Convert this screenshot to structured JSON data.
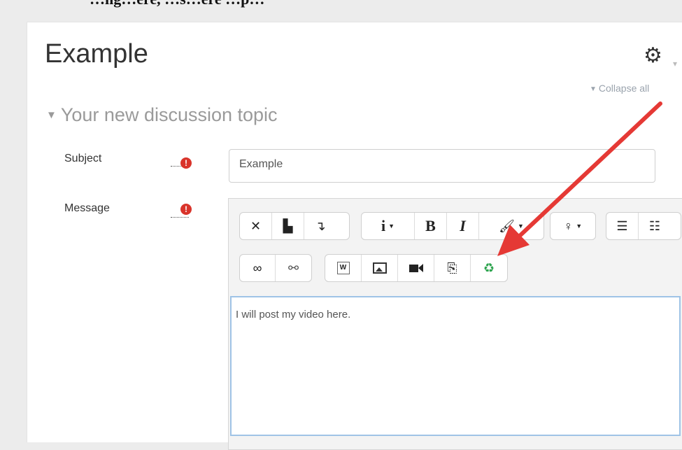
{
  "caption": "…ng…ere, …s…ere …p…",
  "page": {
    "title": "Example"
  },
  "header": {
    "gear_icon": "gear-icon",
    "collapse_all": "Collapse all"
  },
  "section": {
    "title": "Your new discussion topic"
  },
  "form": {
    "subject_label": "Subject",
    "subject_value": "Example",
    "message_label": "Message",
    "required_symbol": "!",
    "message_text": "I will post my video here."
  },
  "toolbar": {
    "row1_group1": [
      "fullscreen-icon",
      "paste-icon",
      "indent-icon"
    ],
    "row1_group2": [
      "info-icon",
      "bold-icon",
      "italic-icon",
      "brush-icon"
    ],
    "row1_group3": [
      "bulb-icon"
    ],
    "row1_group4": [
      "bullet-list-icon",
      "numbered-list-icon"
    ],
    "row2_group1": [
      "link-icon",
      "unlink-icon"
    ],
    "row2_group2": [
      "word-icon",
      "image-icon",
      "video-icon",
      "copy-icon",
      "recycle-icon"
    ]
  },
  "colors": {
    "required": "#d9342b",
    "arrow": "#e53935",
    "focus_border": "#9fc3e6"
  }
}
